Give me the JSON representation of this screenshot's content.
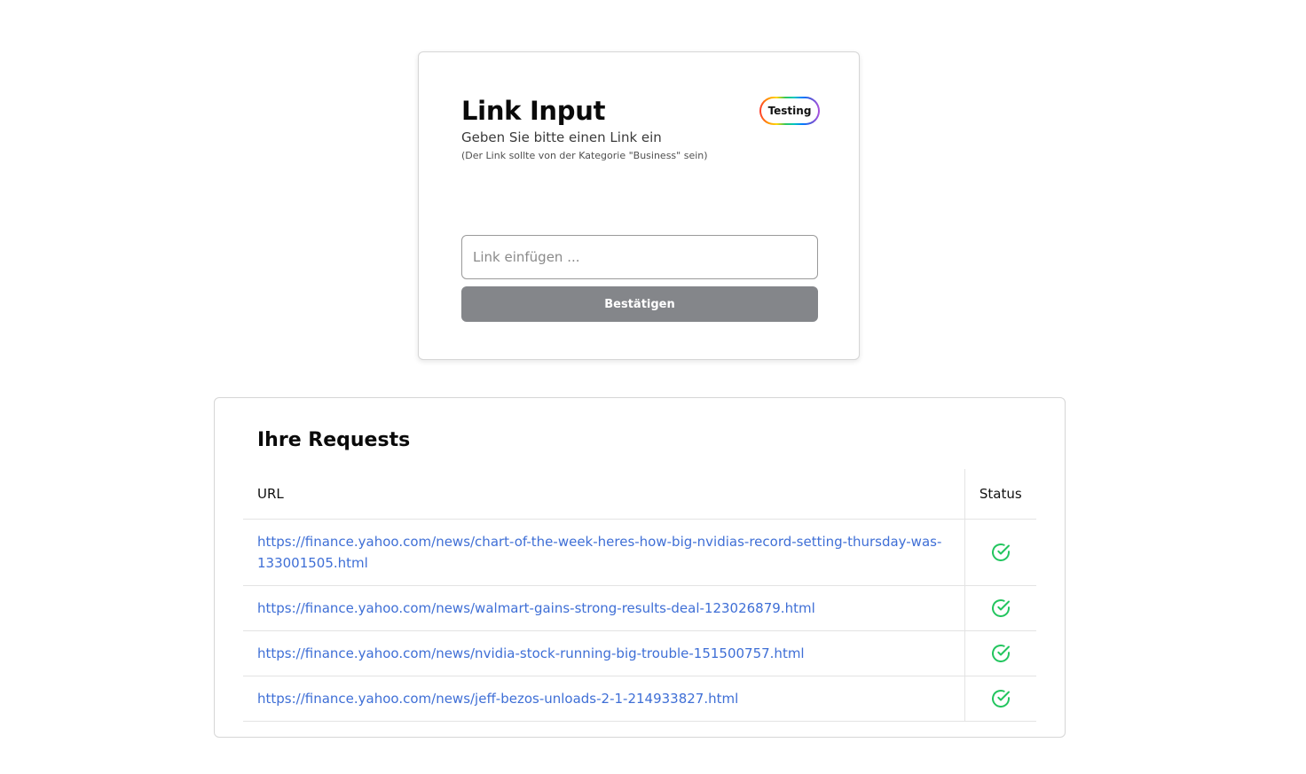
{
  "link_input": {
    "title": "Link Input",
    "subtitle": "Geben Sie bitte einen Link ein",
    "hint": "(Der Link sollte von der Kategorie \"Business\" sein)",
    "badge": "Testing",
    "input_placeholder": "Link einfügen ...",
    "input_value": "",
    "submit_label": "Bestätigen",
    "submit_color": "#84868a"
  },
  "requests": {
    "title": "Ihre Requests",
    "columns": [
      "URL",
      "Status"
    ],
    "rows": [
      {
        "url": "https://finance.yahoo.com/news/chart-of-the-week-heres-how-big-nvidias-record-setting-thursday-was-133001505.html",
        "status": "check-circle-icon"
      },
      {
        "url": "https://finance.yahoo.com/news/walmart-gains-strong-results-deal-123026879.html",
        "status": "check-circle-icon"
      },
      {
        "url": "https://finance.yahoo.com/news/nvidia-stock-running-big-trouble-151500757.html",
        "status": "check-circle-icon"
      },
      {
        "url": "https://finance.yahoo.com/news/jeff-bezos-unloads-2-1-214933827.html",
        "status": "check-circle-icon"
      }
    ],
    "link_color": "#3f6fd6",
    "status_success_color": "#22c55e"
  }
}
